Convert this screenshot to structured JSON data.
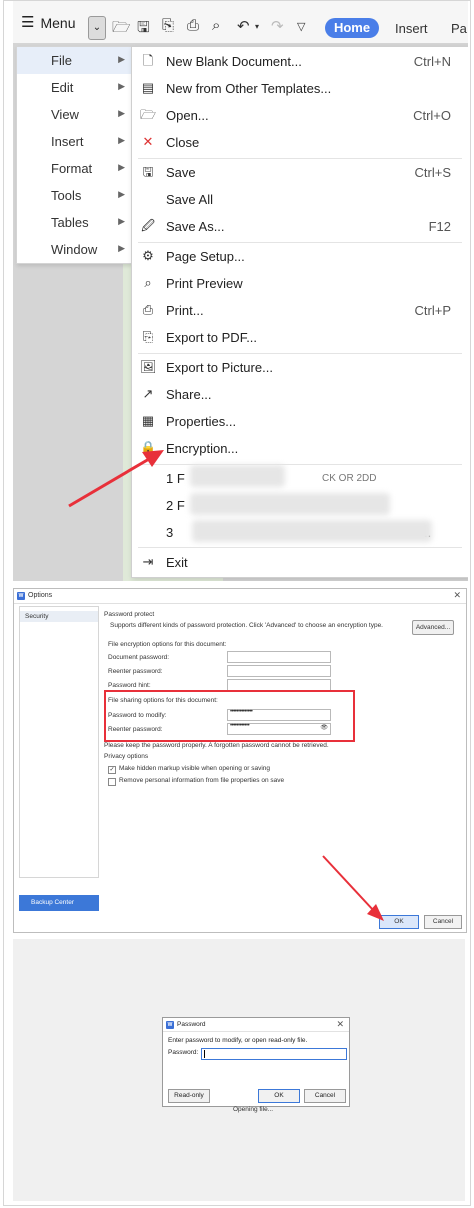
{
  "toolbar": {
    "menu_label": "Menu",
    "home_tab": "Home",
    "insert_tab": "Insert",
    "partial_tab": "Pa"
  },
  "main_menu": {
    "items": [
      {
        "label": "File"
      },
      {
        "label": "Edit"
      },
      {
        "label": "View"
      },
      {
        "label": "Insert"
      },
      {
        "label": "Format"
      },
      {
        "label": "Tools"
      },
      {
        "label": "Tables"
      },
      {
        "label": "Window"
      }
    ]
  },
  "file_menu": {
    "items": [
      {
        "icon": "new-doc-icon",
        "label": "New Blank Document...",
        "shortcut": "Ctrl+N"
      },
      {
        "icon": "template-icon",
        "label": "New from Other Templates...",
        "shortcut": ""
      },
      {
        "icon": "open-folder-icon",
        "label": "Open...",
        "shortcut": "Ctrl+O"
      },
      {
        "icon": "close-doc-icon",
        "label": "Close",
        "shortcut": ""
      },
      {
        "icon": "save-icon",
        "label": "Save",
        "shortcut": "Ctrl+S"
      },
      {
        "icon": "",
        "label": "Save All",
        "shortcut": ""
      },
      {
        "icon": "save-as-icon",
        "label": "Save As...",
        "shortcut": "F12"
      },
      {
        "icon": "page-setup-icon",
        "label": "Page Setup...",
        "shortcut": ""
      },
      {
        "icon": "print-preview-icon",
        "label": "Print Preview",
        "shortcut": ""
      },
      {
        "icon": "printer-icon",
        "label": "Print...",
        "shortcut": "Ctrl+P"
      },
      {
        "icon": "pdf-icon",
        "label": "Export to PDF...",
        "shortcut": ""
      },
      {
        "icon": "picture-icon",
        "label": "Export to Picture...",
        "shortcut": ""
      },
      {
        "icon": "share-icon",
        "label": "Share...",
        "shortcut": ""
      },
      {
        "icon": "properties-icon",
        "label": "Properties...",
        "shortcut": ""
      },
      {
        "icon": "encryption-icon",
        "label": "Encryption...",
        "shortcut": ""
      }
    ],
    "recent": [
      {
        "label": "1 F",
        "suffix": "CK OR 2DD"
      },
      {
        "label": "2 F",
        "suffix": ""
      },
      {
        "label": "3",
        "suffix": ".."
      }
    ],
    "exit_label": "Exit"
  },
  "options_dialog": {
    "title": "Options",
    "sidebar_item": "Security",
    "backup_label": "Backup Center",
    "section_protect": "Password protect",
    "protect_desc": "Supports different kinds of password protection. Click 'Advanced' to choose an encryption type.",
    "advanced_label": "Advanced...",
    "encryption_heading": "File encryption options for this document:",
    "doc_password_label": "Document password:",
    "reenter_label_1": "Reenter password:",
    "hint_label": "Password hint:",
    "sharing_heading": "File sharing options for this document:",
    "modify_password_label": "Password to modify:",
    "modify_password_value": "••••••••••••••",
    "reenter_label_2": "Reenter password:",
    "reenter_value_2": "••••••••••••",
    "warning": "Please keep the password properly. A forgotten password cannot be retrieved.",
    "privacy_heading": "Privacy options",
    "privacy_opt1": "Make hidden markup visible when opening or saving",
    "privacy_opt2": "Remove personal information from file properties on save",
    "ok_label": "OK",
    "cancel_label": "Cancel"
  },
  "password_dialog": {
    "title": "Password",
    "instruction": "Enter password to modify, or open read-only file.",
    "password_label": "Password:",
    "readonly_label": "Read-only",
    "ok_label": "OK",
    "cancel_label": "Cancel",
    "status": "Opening file..."
  }
}
